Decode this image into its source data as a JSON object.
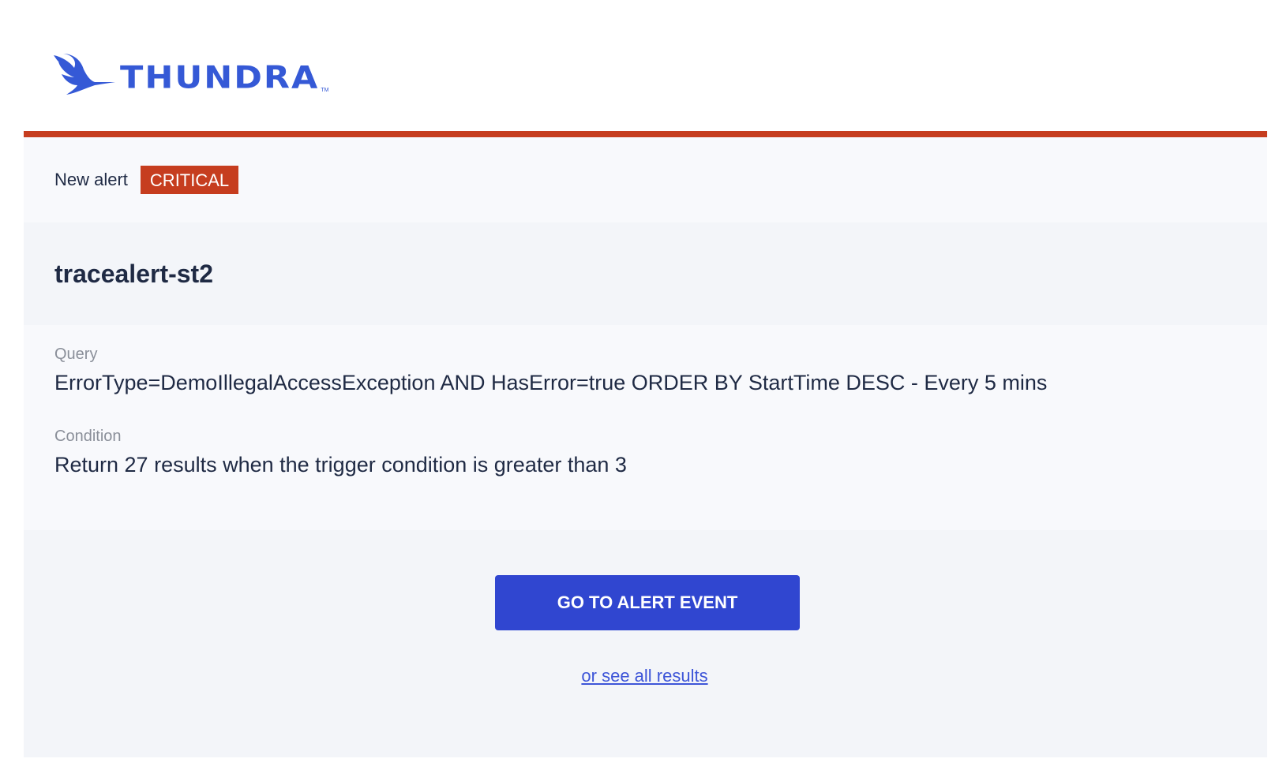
{
  "brand": {
    "name": "THUNDRA",
    "trademark": "TM",
    "logo_icon": "bird-icon",
    "color": "#3559d6"
  },
  "colors": {
    "accent": "#c63d1f",
    "button": "#3046d0",
    "link": "#3d55d8",
    "text": "#1f2a44",
    "muted": "#8a8f99"
  },
  "alert": {
    "label": "New alert",
    "severity": "CRITICAL",
    "name": "tracealert-st2"
  },
  "details": {
    "query_label": "Query",
    "query_value": "ErrorType=DemoIllegalAccessException AND HasError=true ORDER BY StartTime DESC - Every 5 mins",
    "condition_label": "Condition",
    "condition_value": "Return 27 results when the trigger condition is greater than 3"
  },
  "actions": {
    "primary_button": "GO TO ALERT EVENT",
    "secondary_link": "or see all results"
  }
}
